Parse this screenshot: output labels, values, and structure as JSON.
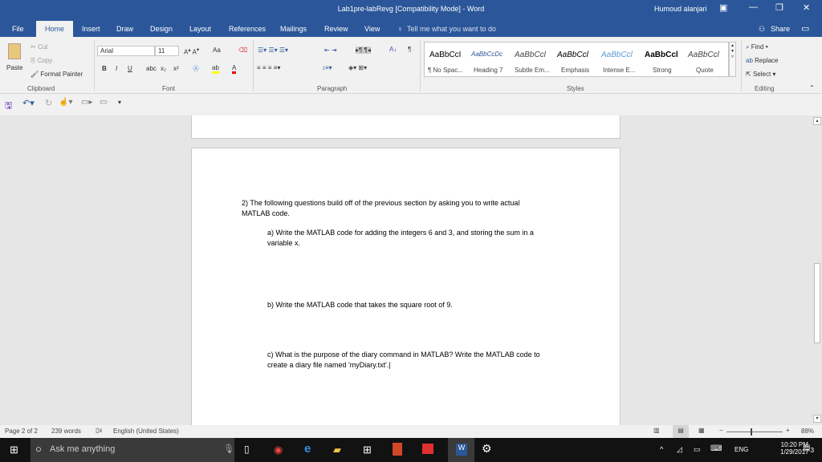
{
  "window": {
    "title": "Lab1pre-labRevg [Compatibility Mode]  -  Word",
    "user": "Humoud alanjari"
  },
  "tabs": [
    "File",
    "Home",
    "Insert",
    "Draw",
    "Design",
    "Layout",
    "References",
    "Mailings",
    "Review",
    "View"
  ],
  "tell_me": "Tell me what you want to do",
  "share": "Share",
  "clipboard": {
    "paste": "Paste",
    "cut": "Cut",
    "copy": "Copy",
    "format_painter": "Format Painter",
    "label": "Clipboard"
  },
  "font": {
    "name": "Arial",
    "size": "11",
    "label": "Font",
    "bold": "B",
    "italic": "I",
    "underline": "U",
    "strike": "abc",
    "sub": "x₂",
    "sup": "x²",
    "case": "Aa"
  },
  "paragraph": {
    "label": "Paragraph"
  },
  "styles": {
    "label": "Styles",
    "items": [
      {
        "sample": "AaBbCcI",
        "name": "¶ No Spac..."
      },
      {
        "sample": "AaBbCcDc",
        "name": "Heading 7"
      },
      {
        "sample": "AaBbCcl",
        "name": "Subtle Em..."
      },
      {
        "sample": "AaBbCcl",
        "name": "Emphasis"
      },
      {
        "sample": "AaBbCcl",
        "name": "Intense E..."
      },
      {
        "sample": "AaBbCcl",
        "name": "Strong"
      },
      {
        "sample": "AaBbCcl",
        "name": "Quote"
      }
    ]
  },
  "editing": {
    "find": "Find",
    "replace": "Replace",
    "select": "Select",
    "label": "Editing"
  },
  "document": {
    "lines": [
      "2) The following questions build off of the previous section by asking you to write actual",
      "MATLAB code.",
      "a) Write the MATLAB code for adding the integers 6 and 3, and storing the sum in a",
      "variable x.",
      "b) Write the MATLAB code that takes the square root of 9.",
      "c) What is the purpose of the diary command in MATLAB? Write the MATLAB code to",
      "create a diary file named 'myDiary.txt'."
    ]
  },
  "status": {
    "page": "Page 2 of 2",
    "words": "239 words",
    "language": "English (United States)",
    "zoom": "88%",
    "zoom_percent": 88
  },
  "taskbar": {
    "search": "Ask me anything",
    "lang": "ENG",
    "time": "10:20 PM",
    "date": "1/29/2017",
    "notifications": "3"
  }
}
